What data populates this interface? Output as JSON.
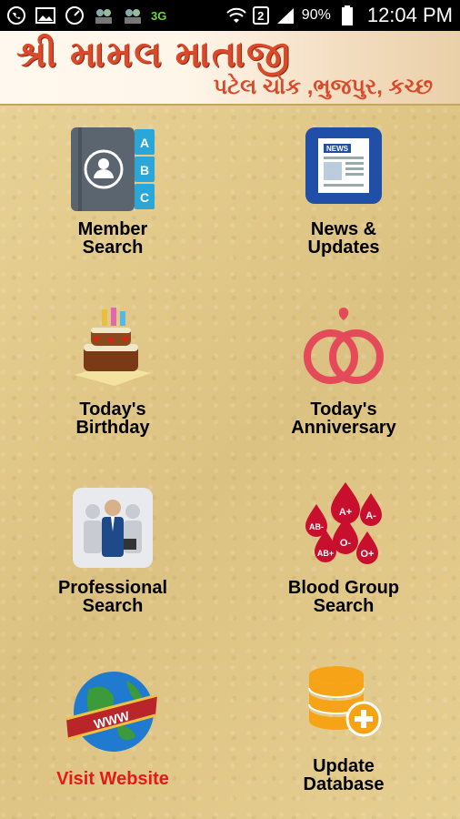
{
  "status_bar": {
    "sim_badge": "2",
    "battery": "90%",
    "time": "12:04 PM",
    "network": "3G"
  },
  "header": {
    "title": "શ્રી મામલ માતાજી",
    "subtitle": "પટેલ ચોક ,ભુજપુર, કચ્છ"
  },
  "tiles": [
    {
      "line1": "Member",
      "line2": "Search",
      "icon": "address-book-icon"
    },
    {
      "line1": "News &",
      "line2": "Updates",
      "icon": "newspaper-icon"
    },
    {
      "line1": "Today's",
      "line2": "Birthday",
      "icon": "birthday-cake-icon"
    },
    {
      "line1": "Today's",
      "line2": "Anniversary",
      "icon": "wedding-rings-icon"
    },
    {
      "line1": "Professional",
      "line2": "Search",
      "icon": "professionals-icon"
    },
    {
      "line1": "Blood Group",
      "line2": "Search",
      "icon": "blood-drops-icon"
    },
    {
      "line1": "Visit Website",
      "line2": "",
      "icon": "globe-www-icon"
    },
    {
      "line1": "Update",
      "line2": "Database",
      "icon": "database-add-icon"
    }
  ],
  "blood_groups": [
    "A+",
    "A-",
    "AB-",
    "O-",
    "AB+",
    "O+"
  ],
  "address_tabs": [
    "A",
    "B",
    "C"
  ],
  "news_label": "NEWS",
  "www_label": "WWW",
  "colors": {
    "header_text": "#d84a2a",
    "background": "#e3cd8f",
    "visit_website": "#e41a1a"
  }
}
